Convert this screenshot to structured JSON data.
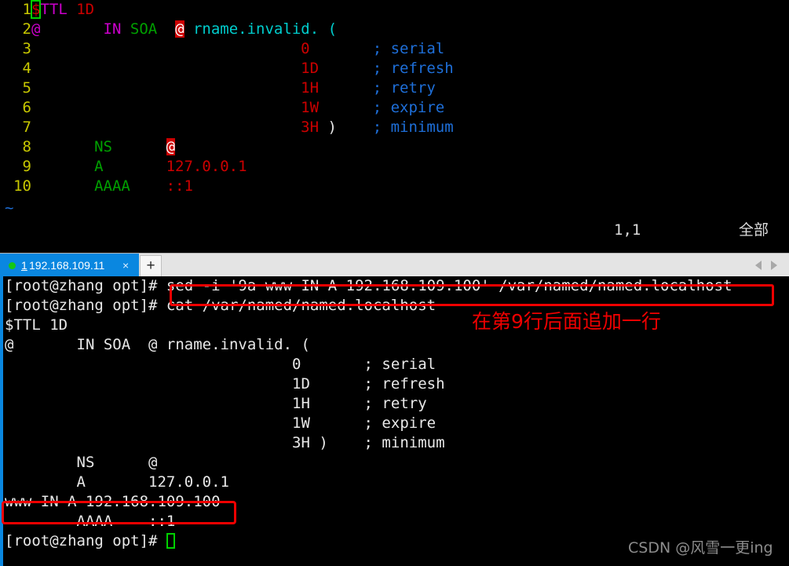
{
  "vim": {
    "lines": [
      {
        "num": "1",
        "segments": [
          {
            "text": "$",
            "color": "red",
            "cursor": true
          },
          {
            "text": "TTL",
            "color": "magenta"
          },
          {
            "text": " ",
            "color": "white"
          },
          {
            "text": "1D",
            "color": "red"
          }
        ]
      },
      {
        "num": "2",
        "segments": [
          {
            "text": "@",
            "color": "magenta"
          },
          {
            "text": "       ",
            "color": "white"
          },
          {
            "text": "IN",
            "color": "magenta"
          },
          {
            "text": " ",
            "color": "white"
          },
          {
            "text": "SOA",
            "color": "green"
          },
          {
            "text": "  ",
            "color": "white"
          },
          {
            "text": "@",
            "color": "reverse"
          },
          {
            "text": " rname.invalid. (",
            "color": "cyan"
          }
        ]
      },
      {
        "num": "3",
        "segments": [
          {
            "text": "                              ",
            "color": "white"
          },
          {
            "text": "0",
            "color": "red"
          },
          {
            "text": "       ",
            "color": "white"
          },
          {
            "text": "; serial",
            "color": "blue"
          }
        ]
      },
      {
        "num": "4",
        "segments": [
          {
            "text": "                              ",
            "color": "white"
          },
          {
            "text": "1D",
            "color": "red"
          },
          {
            "text": "      ",
            "color": "white"
          },
          {
            "text": "; refresh",
            "color": "blue"
          }
        ]
      },
      {
        "num": "5",
        "segments": [
          {
            "text": "                              ",
            "color": "white"
          },
          {
            "text": "1H",
            "color": "red"
          },
          {
            "text": "      ",
            "color": "white"
          },
          {
            "text": "; retry",
            "color": "blue"
          }
        ]
      },
      {
        "num": "6",
        "segments": [
          {
            "text": "                              ",
            "color": "white"
          },
          {
            "text": "1W",
            "color": "red"
          },
          {
            "text": "      ",
            "color": "white"
          },
          {
            "text": "; expire",
            "color": "blue"
          }
        ]
      },
      {
        "num": "7",
        "segments": [
          {
            "text": "                              ",
            "color": "white"
          },
          {
            "text": "3H",
            "color": "red"
          },
          {
            "text": " )",
            "color": "white"
          },
          {
            "text": "    ",
            "color": "white"
          },
          {
            "text": "; minimum",
            "color": "blue"
          }
        ]
      },
      {
        "num": "8",
        "segments": [
          {
            "text": "       ",
            "color": "white"
          },
          {
            "text": "NS",
            "color": "green"
          },
          {
            "text": "      ",
            "color": "white"
          },
          {
            "text": "@",
            "color": "reverse"
          }
        ]
      },
      {
        "num": "9",
        "segments": [
          {
            "text": "       ",
            "color": "white"
          },
          {
            "text": "A",
            "color": "green"
          },
          {
            "text": "       ",
            "color": "white"
          },
          {
            "text": "127.0.0.1",
            "color": "red"
          }
        ]
      },
      {
        "num": "10",
        "segments": [
          {
            "text": "       ",
            "color": "white"
          },
          {
            "text": "AAAA",
            "color": "green"
          },
          {
            "text": "    ",
            "color": "white"
          },
          {
            "text": "::1",
            "color": "red"
          }
        ]
      }
    ],
    "empty_marker": "~",
    "status": {
      "position": "1,1",
      "scope": "全部"
    }
  },
  "tabbar": {
    "active_tab": {
      "number": "1",
      "title": "192.168.109.11",
      "close_label": "×",
      "status_dot_color": "#14c814"
    },
    "new_tab_label": "+",
    "scroll_left_icon": "chevron-left-icon",
    "scroll_right_icon": "chevron-right-icon"
  },
  "terminal": {
    "prompt": "[root@zhang opt]# ",
    "lines": [
      "[root@zhang opt]# sed -i '9a www IN A 192.168.109.100' /var/named/named.localhost",
      "[root@zhang opt]# cat /var/named/named.localhost",
      "$TTL 1D",
      "@       IN SOA  @ rname.invalid. (",
      "                                0       ; serial",
      "                                1D      ; refresh",
      "                                1H      ; retry",
      "                                1W      ; expire",
      "                                3H )    ; minimum",
      "        NS      @",
      "        A       127.0.0.1",
      "www IN A 192.168.109.100",
      "        AAAA    ::1"
    ],
    "final_prompt": "[root@zhang opt]# ",
    "commands": {
      "sed_command": "sed -i '9a www IN A 192.168.109.100' /var/named/named.localhost",
      "cat_command": "cat /var/named/named.localhost"
    },
    "highlighted_record": "www IN A 192.168.109.100"
  },
  "annotations": {
    "chinese_note": "在第9行后面追加一行",
    "box_color": "#f00000"
  },
  "watermark": "CSDN @风雪一更ing"
}
